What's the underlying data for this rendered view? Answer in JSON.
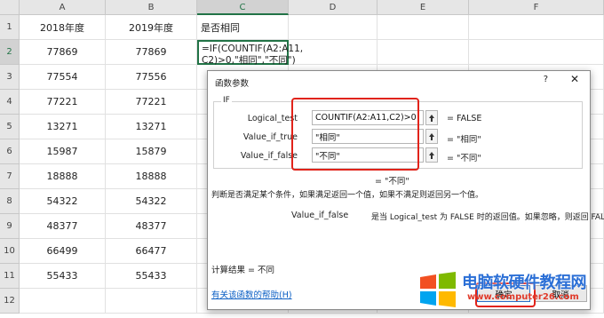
{
  "sheet": {
    "columns": [
      "A",
      "B",
      "C",
      "D",
      "E",
      "F"
    ],
    "selected_column": "C",
    "rows": [
      "1",
      "2",
      "3",
      "4",
      "5",
      "6",
      "7",
      "8",
      "9",
      "10",
      "11",
      "12"
    ],
    "selected_row": "2",
    "header_row": [
      "2018年度",
      "2019年度",
      "是否相同"
    ],
    "data_a": [
      "77869",
      "77554",
      "77221",
      "13271",
      "15987",
      "18888",
      "54322",
      "48377",
      "66499",
      "55433"
    ],
    "data_b": [
      "77869",
      "77556",
      "77221",
      "13271",
      "15879",
      "18888",
      "54322",
      "48377",
      "66477",
      "55433"
    ],
    "active_cell_formula": "=IF(COUNTIF(A2:A11,\nC2)>0,\"相同\",\"不同\")"
  },
  "dialog": {
    "title": "函数参数",
    "help_glyph": "?",
    "close_glyph": "✕",
    "function_name": "IF",
    "args": [
      {
        "label": "Logical_test",
        "value": "COUNTIF(A2:A11,C2)>0",
        "result": "=  FALSE"
      },
      {
        "label": "Value_if_true",
        "value": "\"相同\"",
        "result": "=  \"相同\""
      },
      {
        "label": "Value_if_false",
        "value": "\"不同\"",
        "result": "=  \"不同\""
      }
    ],
    "overall_result": "=  \"不同\"",
    "description": "判断是否满足某个条件，如果满足返回一个值，如果不满足则返回另一个值。",
    "arg_help_name": "Value_if_false",
    "arg_help_text": "是当 Logical_test 为 FALSE 时的返回值。如果忽略，则返回 FALSE",
    "calc_result": "计算结果 =   不同",
    "help_link": "有关该函数的帮助(H)",
    "ok_label": "确定",
    "cancel_label": "取消"
  },
  "watermark": {
    "title": "电脑软硬件教程网",
    "url": "www.computer26.com"
  },
  "colors": {
    "accent_green": "#217346",
    "highlight_red": "#e1231a",
    "link_blue": "#0b5fc4"
  }
}
